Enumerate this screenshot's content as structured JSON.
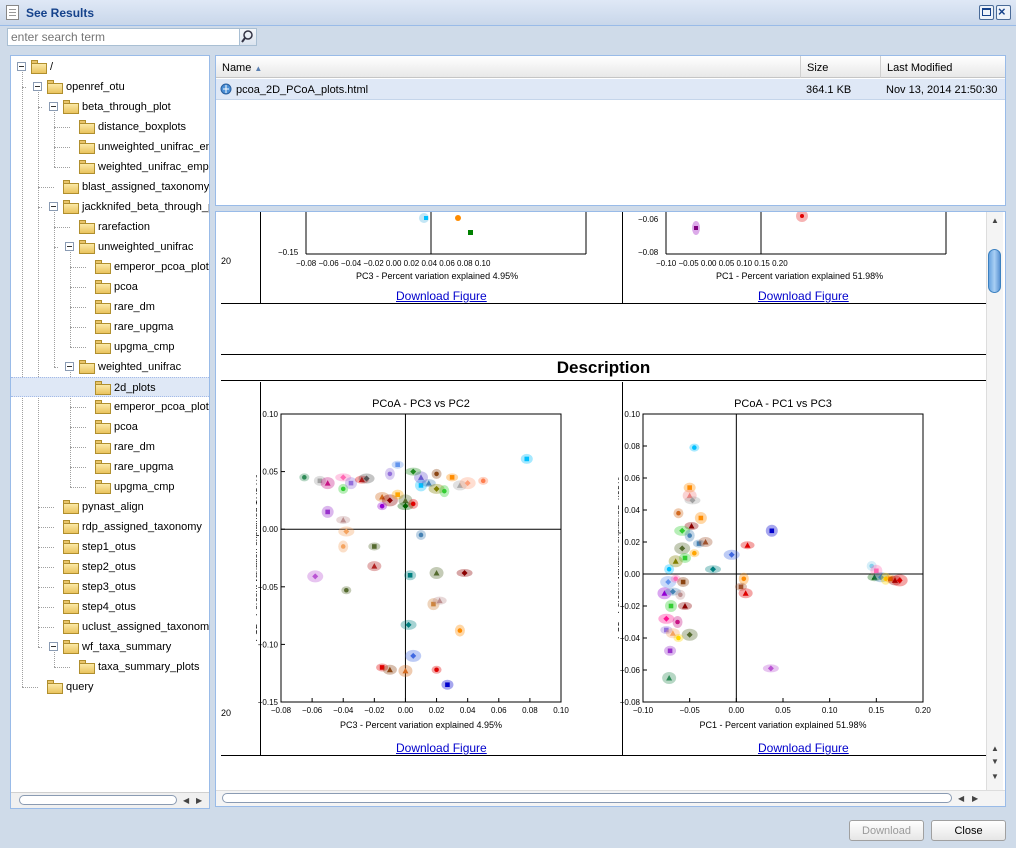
{
  "window": {
    "title": "See Results"
  },
  "search": {
    "placeholder": "enter search term"
  },
  "tree": {
    "nodes": [
      {
        "label": "/",
        "depth": 0,
        "expanded": true
      },
      {
        "label": "openref_otu",
        "depth": 1,
        "expanded": true
      },
      {
        "label": "beta_through_plot",
        "depth": 2,
        "expanded": true
      },
      {
        "label": "distance_boxplots",
        "depth": 3
      },
      {
        "label": "unweighted_unifrac_em",
        "depth": 3
      },
      {
        "label": "weighted_unifrac_empe",
        "depth": 3
      },
      {
        "label": "blast_assigned_taxonomy",
        "depth": 2
      },
      {
        "label": "jackknifed_beta_through_p",
        "depth": 2,
        "expanded": true
      },
      {
        "label": "rarefaction",
        "depth": 3
      },
      {
        "label": "unweighted_unifrac",
        "depth": 3,
        "expanded": true
      },
      {
        "label": "emperor_pcoa_plots",
        "depth": 4
      },
      {
        "label": "pcoa",
        "depth": 4
      },
      {
        "label": "rare_dm",
        "depth": 4
      },
      {
        "label": "rare_upgma",
        "depth": 4
      },
      {
        "label": "upgma_cmp",
        "depth": 4
      },
      {
        "label": "weighted_unifrac",
        "depth": 3,
        "expanded": true
      },
      {
        "label": "2d_plots",
        "depth": 4,
        "selected": true
      },
      {
        "label": "emperor_pcoa_plots",
        "depth": 4
      },
      {
        "label": "pcoa",
        "depth": 4
      },
      {
        "label": "rare_dm",
        "depth": 4
      },
      {
        "label": "rare_upgma",
        "depth": 4
      },
      {
        "label": "upgma_cmp",
        "depth": 4
      },
      {
        "label": "pynast_align",
        "depth": 2
      },
      {
        "label": "rdp_assigned_taxonomy",
        "depth": 2
      },
      {
        "label": "step1_otus",
        "depth": 2
      },
      {
        "label": "step2_otus",
        "depth": 2
      },
      {
        "label": "step3_otus",
        "depth": 2
      },
      {
        "label": "step4_otus",
        "depth": 2
      },
      {
        "label": "uclust_assigned_taxonomy",
        "depth": 2
      },
      {
        "label": "wf_taxa_summary",
        "depth": 2,
        "expanded": true
      },
      {
        "label": "taxa_summary_plots",
        "depth": 3
      },
      {
        "label": "query",
        "depth": 1
      }
    ]
  },
  "grid": {
    "columns": {
      "name": "Name",
      "size": "Size",
      "modified": "Last Modified"
    },
    "rows": [
      {
        "name": "pcoa_2D_PCoA_plots.html",
        "size": "364.1 KB",
        "modified": "Nov 13, 2014 21:50:30"
      }
    ]
  },
  "viewer": {
    "download_link": "Download Figure",
    "description_heading": "Description",
    "top_left_xlabel": "PC3 - Percent variation explained 4.95%",
    "top_right_xlabel": "PC1 - Percent variation explained 51.98%",
    "left_edge_label": "20"
  },
  "chart_data": [
    {
      "type": "scatter",
      "title": "PCoA - PC3 vs PC2",
      "xlabel": "PC3 - Percent variation explained 4.95%",
      "ylabel": "PC2 - Percent variation explained 17.34%",
      "xlim": [
        -0.08,
        0.1
      ],
      "ylim": [
        -0.15,
        0.1
      ],
      "xticks": [
        "−0.08",
        "−0.06",
        "−0.04",
        "−0.02",
        "0.00",
        "0.02",
        "0.04",
        "0.06",
        "0.08",
        "0.10"
      ],
      "yticks": [
        "−0.15",
        "−0.10",
        "−0.05",
        "0.00",
        "0.05",
        "0.10"
      ],
      "points": [
        [
          -0.065,
          0.045,
          "#2e8b57"
        ],
        [
          -0.055,
          0.042,
          "#a0a0a0"
        ],
        [
          -0.05,
          0.04,
          "#c71585"
        ],
        [
          -0.04,
          0.045,
          "#ff69b4"
        ],
        [
          -0.04,
          0.035,
          "#32cd32"
        ],
        [
          -0.035,
          0.04,
          "#9370db"
        ],
        [
          -0.028,
          0.043,
          "#e00000"
        ],
        [
          -0.025,
          0.044,
          "#555555"
        ],
        [
          -0.01,
          0.048,
          "#9370db"
        ],
        [
          -0.005,
          0.056,
          "#6495ed"
        ],
        [
          -0.015,
          0.028,
          "#d2691e"
        ],
        [
          -0.01,
          0.025,
          "#8b0000"
        ],
        [
          -0.015,
          0.02,
          "#9400d3"
        ],
        [
          -0.005,
          0.03,
          "#ffa500"
        ],
        [
          0.0,
          0.025,
          "#556b2f"
        ],
        [
          0.0,
          0.02,
          "#006400"
        ],
        [
          0.005,
          0.022,
          "#e00000"
        ],
        [
          0.01,
          0.038,
          "#00bfff"
        ],
        [
          0.015,
          0.04,
          "#4682b4"
        ],
        [
          0.02,
          0.035,
          "#808000"
        ],
        [
          0.025,
          0.033,
          "#32cd32"
        ],
        [
          0.03,
          0.045,
          "#ff8c00"
        ],
        [
          0.035,
          0.038,
          "#a9a9a9"
        ],
        [
          0.04,
          0.04,
          "#ffa07a"
        ],
        [
          0.05,
          0.042,
          "#ff7f50"
        ],
        [
          0.078,
          0.061,
          "#00bfff"
        ],
        [
          0.01,
          0.045,
          "#6a5acd"
        ],
        [
          0.005,
          0.05,
          "#228b22"
        ],
        [
          0.02,
          0.048,
          "#8b4513"
        ],
        [
          -0.05,
          0.015,
          "#9932cc"
        ],
        [
          -0.04,
          0.008,
          "#bc8f8f"
        ],
        [
          -0.038,
          -0.002,
          "#f4a460"
        ],
        [
          -0.04,
          -0.015,
          "#f4a460"
        ],
        [
          -0.02,
          -0.015,
          "#556b2f"
        ],
        [
          -0.02,
          -0.032,
          "#b22222"
        ],
        [
          -0.058,
          -0.041,
          "#ba55d3"
        ],
        [
          -0.038,
          -0.053,
          "#556b2f"
        ],
        [
          0.003,
          -0.04,
          "#008080"
        ],
        [
          0.02,
          -0.038,
          "#556b2f"
        ],
        [
          0.038,
          -0.038,
          "#8b0000"
        ],
        [
          0.01,
          -0.005,
          "#4682b4"
        ],
        [
          0.018,
          -0.065,
          "#cd853f"
        ],
        [
          0.022,
          -0.062,
          "#bc8f8f"
        ],
        [
          0.002,
          -0.083,
          "#008080"
        ],
        [
          0.035,
          -0.088,
          "#ff8c00"
        ],
        [
          -0.015,
          -0.12,
          "#e00000"
        ],
        [
          -0.01,
          -0.122,
          "#8b4513"
        ],
        [
          0.005,
          -0.11,
          "#4169e1"
        ],
        [
          0.02,
          -0.122,
          "#e00000"
        ],
        [
          0.027,
          -0.135,
          "#0000cd"
        ],
        [
          0.0,
          -0.123,
          "#d2691e"
        ]
      ]
    },
    {
      "type": "scatter",
      "title": "PCoA - PC1 vs PC3",
      "xlabel": "PC1 - Percent variation explained 51.98%",
      "ylabel": "PC3 - Percent variation explained 4.95%",
      "xlim": [
        -0.1,
        0.2
      ],
      "ylim": [
        -0.08,
        0.1
      ],
      "xticks": [
        "−0.10",
        "−0.05",
        "0.00",
        "0.05",
        "0.10",
        "0.15",
        "0.20"
      ],
      "yticks": [
        "−0.08",
        "−0.06",
        "−0.04",
        "−0.02",
        "0.00",
        "0.02",
        "0.04",
        "0.06",
        "0.08",
        "0.10"
      ],
      "points": [
        [
          -0.045,
          0.079,
          "#00bfff"
        ],
        [
          -0.05,
          0.054,
          "#ff8c00"
        ],
        [
          -0.05,
          0.049,
          "#f08080"
        ],
        [
          -0.047,
          0.046,
          "#a0a0a0"
        ],
        [
          -0.062,
          0.038,
          "#d2691e"
        ],
        [
          -0.038,
          0.035,
          "#ff8c00"
        ],
        [
          -0.048,
          0.03,
          "#8b0000"
        ],
        [
          -0.058,
          0.027,
          "#32cd32"
        ],
        [
          -0.05,
          0.024,
          "#4682b4"
        ],
        [
          -0.04,
          0.019,
          "#4682b4"
        ],
        [
          -0.033,
          0.02,
          "#a0522d"
        ],
        [
          -0.058,
          0.016,
          "#556b2f"
        ],
        [
          -0.045,
          0.013,
          "#ffa500"
        ],
        [
          -0.055,
          0.01,
          "#32cd32"
        ],
        [
          -0.065,
          0.008,
          "#808000"
        ],
        [
          -0.025,
          0.003,
          "#008080"
        ],
        [
          -0.072,
          0.003,
          "#00bfff"
        ],
        [
          0.038,
          0.027,
          "#0000cd"
        ],
        [
          0.012,
          0.018,
          "#e00000"
        ],
        [
          -0.005,
          0.012,
          "#4169e1"
        ],
        [
          0.008,
          -0.003,
          "#ff8c00"
        ],
        [
          0.005,
          -0.008,
          "#a0522d"
        ],
        [
          0.01,
          -0.012,
          "#e00000"
        ],
        [
          -0.073,
          -0.005,
          "#6495ed"
        ],
        [
          -0.065,
          -0.003,
          "#ff69b4"
        ],
        [
          -0.057,
          -0.005,
          "#8b4513"
        ],
        [
          -0.077,
          -0.012,
          "#9400d3"
        ],
        [
          -0.068,
          -0.011,
          "#4682b4"
        ],
        [
          -0.06,
          -0.013,
          "#bc8f8f"
        ],
        [
          -0.07,
          -0.02,
          "#32cd32"
        ],
        [
          -0.055,
          -0.02,
          "#8b0000"
        ],
        [
          -0.075,
          -0.028,
          "#ff1493"
        ],
        [
          -0.063,
          -0.03,
          "#c71585"
        ],
        [
          -0.075,
          -0.035,
          "#9370db"
        ],
        [
          -0.068,
          -0.037,
          "#f4a460"
        ],
        [
          -0.05,
          -0.038,
          "#556b2f"
        ],
        [
          -0.062,
          -0.04,
          "#ffd700"
        ],
        [
          -0.071,
          -0.048,
          "#9932cc"
        ],
        [
          -0.072,
          -0.065,
          "#2e8b57"
        ],
        [
          0.037,
          -0.059,
          "#ba55d3"
        ],
        [
          0.145,
          0.005,
          "#87ceeb"
        ],
        [
          0.15,
          0.002,
          "#ff69b4"
        ],
        [
          0.148,
          -0.002,
          "#006400"
        ],
        [
          0.155,
          -0.002,
          "#4682b4"
        ],
        [
          0.16,
          -0.003,
          "#ffd700"
        ],
        [
          0.165,
          -0.003,
          "#ff8c00"
        ],
        [
          0.17,
          -0.004,
          "#8b0000"
        ],
        [
          0.175,
          -0.004,
          "#e00000"
        ]
      ]
    }
  ],
  "buttons": {
    "download": "Download",
    "close": "Close"
  }
}
